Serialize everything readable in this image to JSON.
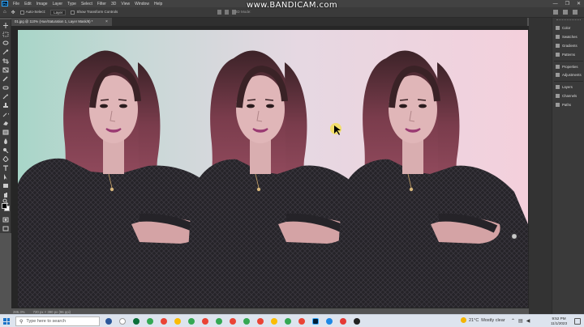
{
  "watermark": "www.BANDICAM.com",
  "menubar": {
    "logo": "Ps",
    "items": [
      "File",
      "Edit",
      "Image",
      "Layer",
      "Type",
      "Select",
      "Filter",
      "3D",
      "View",
      "Window",
      "Help"
    ],
    "window_controls": [
      "—",
      "❐",
      "✕"
    ]
  },
  "options_bar": {
    "auto_select_label": "Auto-Select:",
    "auto_select_value": "Layer",
    "show_transform_controls": "Show Transform Controls",
    "mode_3d": "3D Mode:"
  },
  "document": {
    "tab_title": "01.jpg @ 110% (Hue/Saturation 1, Layer Mask/8) *",
    "zoom": "286.3%",
    "doc_info": "720 px × 390 px (96 ppi)"
  },
  "panels": {
    "group1": [
      "Color",
      "Swatches",
      "Gradients",
      "Patterns"
    ],
    "group2": [
      "Properties",
      "Adjustments"
    ],
    "group3": [
      "Layers",
      "Channels",
      "Paths"
    ]
  },
  "taskbar": {
    "search_placeholder": "Type here to search",
    "weather_temp": "21°C",
    "weather_desc": "Mostly clear",
    "time": "9:52 PM",
    "date": "11/1/2023",
    "app_colors": [
      "#2b579a",
      "#ffffff",
      "#0b6f3a",
      "#34a853",
      "#ea4335",
      "#fbbc05",
      "#34a853",
      "#ea4335",
      "#34a853",
      "#ea4335",
      "#34a853",
      "#ea4335",
      "#fbbc05",
      "#34a853",
      "#ea4335",
      "#31a8ff",
      "#1e88e5",
      "#e53935",
      "#222222"
    ]
  },
  "colors": {
    "app_bg": "#535353",
    "panel_bg": "#3a3a3a",
    "photoshop_blue": "#31a8ff",
    "hair": "#8e4a5e",
    "sweater": "#252328"
  }
}
